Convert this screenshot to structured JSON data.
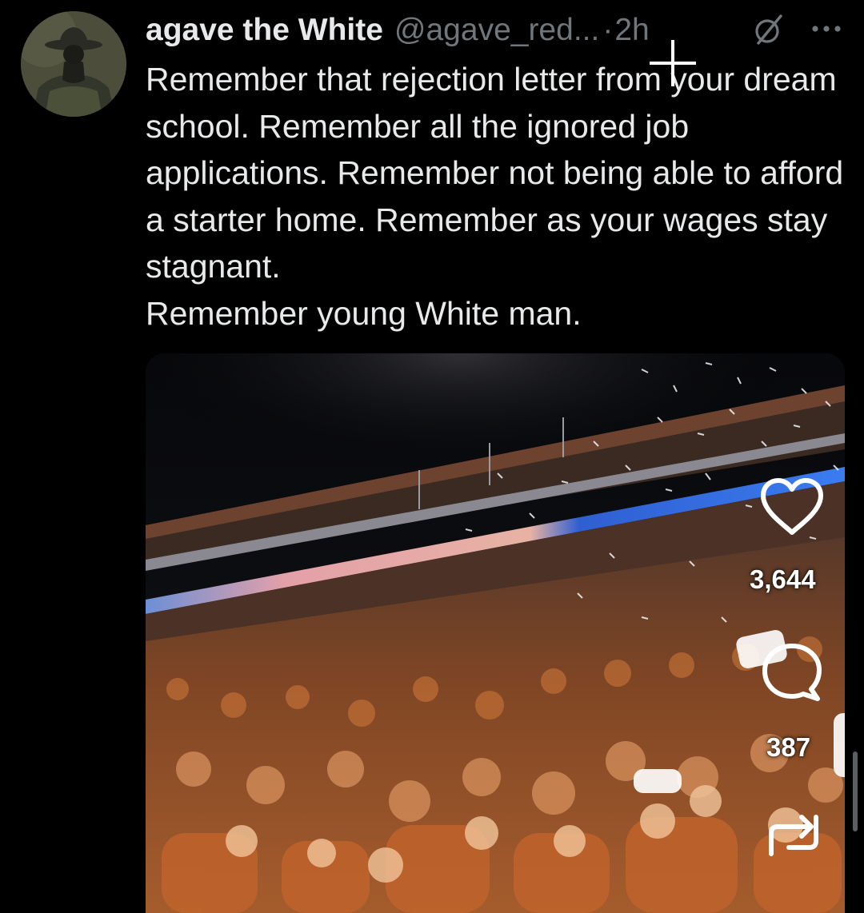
{
  "author": {
    "display_name": "agave the White",
    "handle": "@agave_red...",
    "separator": "·",
    "time": "2h"
  },
  "tweet": {
    "lines": [
      "Remember that rejection letter from your dream school. Remember all the ignored job applications. Remember not being able to afford a starter home. Remember as your wages stay stagnant.",
      "Remember young White man."
    ]
  },
  "media": {
    "icon": "stadium-photo"
  },
  "actions": {
    "like_count": "3,644",
    "reply_count": "387"
  },
  "icons": {
    "grok": "grok-icon",
    "more": "more-icon",
    "like": "heart-icon",
    "reply": "reply-icon",
    "repost": "repost-icon"
  },
  "colors": {
    "background": "#000000",
    "text": "#e7e9ea",
    "secondary": "#71767b",
    "accent_orange": "#c8652a"
  }
}
